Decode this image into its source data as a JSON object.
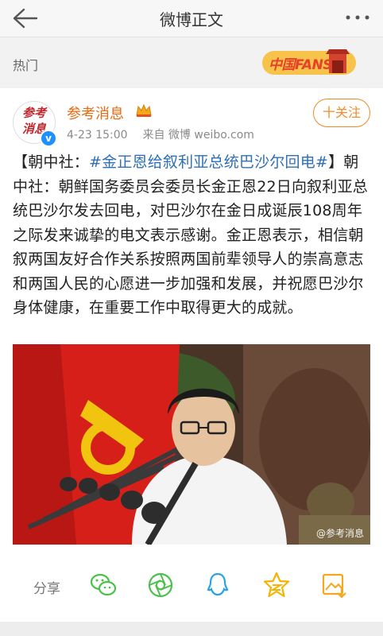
{
  "header": {
    "title": "微博正文"
  },
  "hot": {
    "label": "热门",
    "fans_badge": "中国FANS"
  },
  "post": {
    "author": "参考消息",
    "avatar_text": "参考消息",
    "time": "4-23 15:00",
    "source": "来自 微博 weibo.com",
    "follow_label": "十关注",
    "text_prefix": "【朝中社：",
    "topic": "#金正恩给叙利亚总统巴沙尔回电#",
    "text_body": "】朝中社：朝鲜国务委员会委员长金正恩22日向叙利亚总统巴沙尔发去回电，对巴沙尔在金日成诞辰108周年之际发来诚挚的电文表示感谢。金正恩表示，相信朝叙两国友好合作关系按照两国前辈领导人的崇高意志和两国人民的心愿进一步加强和发展，并祝愿巴沙尔身体健康，在重要工作中取得更大的成就。",
    "watermark": "@参考消息"
  },
  "actions": {
    "share_label": "分享",
    "icons": [
      "wechat-icon",
      "moments-icon",
      "qq-icon",
      "qzone-icon",
      "save-image-icon"
    ]
  },
  "colors": {
    "accent": "#f28a2a",
    "author": "#e86b13",
    "topic": "#2e6fb8",
    "share_green": "#4cc04c",
    "qq_blue": "#29a3e8",
    "qzone_yellow": "#f4b400"
  }
}
